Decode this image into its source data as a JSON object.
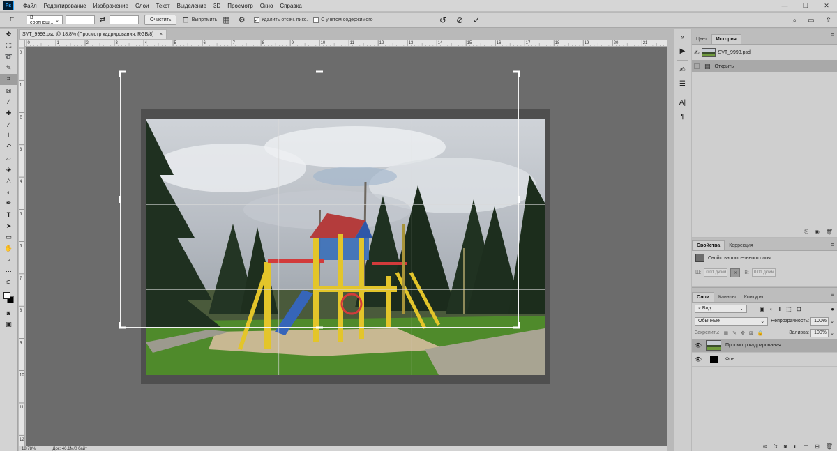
{
  "app": {
    "logo": "Ps"
  },
  "menu": [
    "Файл",
    "Редактирование",
    "Изображение",
    "Слои",
    "Текст",
    "Выделение",
    "3D",
    "Просмотр",
    "Окно",
    "Справка"
  ],
  "window_controls": [
    "—",
    "❐",
    "✕"
  ],
  "options": {
    "ratio_select": "В соотнош...",
    "clear_button": "Очистить",
    "straighten_label": "Выпрямить",
    "delete_cropped_label": "Удалить отсеч. пикс.",
    "content_aware_label": "С учетом содержимого",
    "delete_cropped_checked": true,
    "content_aware_checked": false
  },
  "document": {
    "tab_title": "SVT_9993.psd @ 18,8% (Просмотр кадрирования, RGB/8)",
    "close": "×",
    "zoom": "18,78%",
    "doc_info": "Док: 46,1M/0 байт"
  },
  "ruler_top_labels": [
    "0",
    "1",
    "2",
    "3",
    "4",
    "5",
    "6",
    "7",
    "8",
    "9",
    "10",
    "11",
    "12",
    "13",
    "14",
    "15",
    "16",
    "17",
    "18",
    "19",
    "20",
    "21"
  ],
  "ruler_left_labels": [
    "0",
    "1",
    "2",
    "3",
    "4",
    "5",
    "6",
    "7",
    "8",
    "9",
    "10",
    "11",
    "12"
  ],
  "history_panel": {
    "tabs": [
      "Цвет",
      "История"
    ],
    "active_tab": "История",
    "snapshot_name": "SVT_9993.psd",
    "items": [
      "Открыть"
    ]
  },
  "properties_panel": {
    "tabs": [
      "Свойства",
      "Коррекция"
    ],
    "active_tab": "Свойства",
    "subtitle": "Свойства пиксельного слоя",
    "w_label": "Ш:",
    "w_value": "0,01 дюйм",
    "h_label": "В:",
    "h_value": "0,01 дюйм"
  },
  "layers_panel": {
    "tabs": [
      "Слои",
      "Каналы",
      "Контуры"
    ],
    "active_tab": "Слои",
    "filter_label": "Вид",
    "blend_mode": "Обычные",
    "opacity_label": "Непрозрачность:",
    "opacity_value": "100%",
    "lock_label": "Закрепить:",
    "fill_label": "Заливка:",
    "fill_value": "100%",
    "layers": [
      {
        "name": "Просмотр кадрирования",
        "selected": true
      },
      {
        "name": "Фон",
        "selected": false
      }
    ]
  },
  "colors": {
    "canvas_bg": "#6c6c6c",
    "panel_bg": "#cfcfcf",
    "selected_row": "#a9a9a9"
  }
}
